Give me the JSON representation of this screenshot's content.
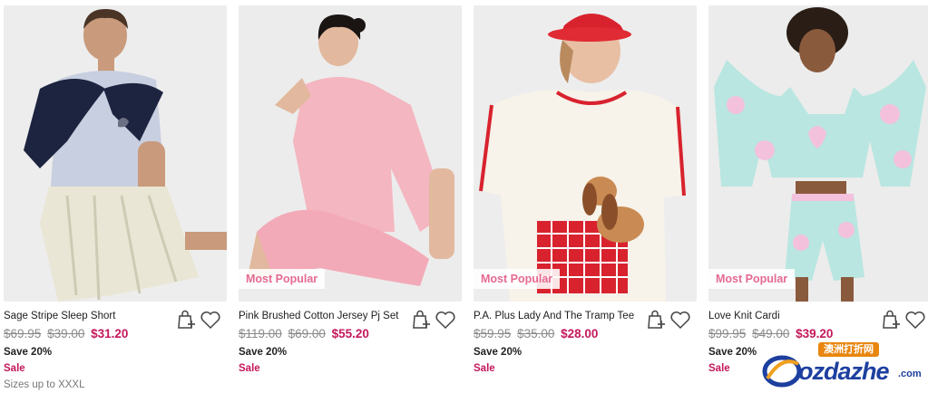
{
  "products": [
    {
      "name": "Sage Stripe Sleep Short",
      "was_prices": [
        "$69.95",
        "$39.00"
      ],
      "price": "$31.20",
      "save": "Save 20%",
      "sale": "Sale",
      "sizes": "Sizes up to XXXL",
      "badge": ""
    },
    {
      "name": "Pink Brushed Cotton Jersey Pj Set",
      "was_prices": [
        "$119.00",
        "$69.00"
      ],
      "price": "$55.20",
      "save": "Save 20%",
      "sale": "Sale",
      "sizes": "",
      "badge": "Most Popular"
    },
    {
      "name": "P.A. Plus Lady And The Tramp Tee",
      "was_prices": [
        "$59.95",
        "$35.00"
      ],
      "price": "$28.00",
      "save": "Save 20%",
      "sale": "Sale",
      "sizes": "",
      "badge": "Most Popular"
    },
    {
      "name": "Love Knit Cardi",
      "was_prices": [
        "$99.95",
        "$49.00"
      ],
      "price": "$39.20",
      "save": "Save 20%",
      "sale": "Sale",
      "sizes": "",
      "badge": "Most Popular"
    }
  ],
  "icons": {
    "bag": "add-to-bag-icon",
    "heart": "wishlist-heart-icon"
  },
  "watermark": {
    "top": "澳洲打折网",
    "text": "ozdazhe",
    "suffix": ".com"
  },
  "colors": {
    "sale": "#c4185b",
    "badge_text": "#e56a93",
    "strike": "#8a8a8a"
  }
}
